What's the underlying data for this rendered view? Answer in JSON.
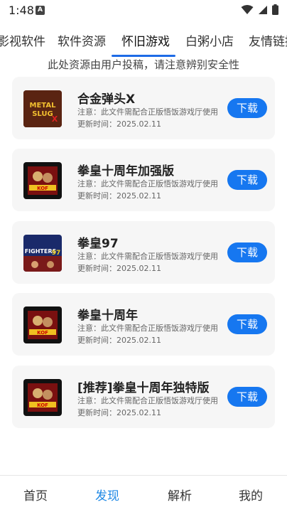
{
  "status": {
    "time": "1:48",
    "notif_letter": "A"
  },
  "tabs": [
    {
      "label": "影视软件",
      "active": false
    },
    {
      "label": "软件资源",
      "active": false
    },
    {
      "label": "怀旧游戏",
      "active": true
    },
    {
      "label": "白粥小店",
      "active": false
    },
    {
      "label": "友情链接",
      "active": false
    }
  ],
  "notice": "此处资源由用户投稿，请注意辨别安全性",
  "items": [
    {
      "title": "合金弹头X",
      "note": "注意：此文件需配合正版悟饭游戏厅使用",
      "date": "更新时间：2025.02.11",
      "button": "下载",
      "thumb_text": "METAL SLUG X"
    },
    {
      "title": "拳皇十周年加强版",
      "note": "注意：此文件需配合正版悟饭游戏厅使用",
      "date": "更新时间：2025.02.11",
      "button": "下载",
      "thumb_text": "KOF"
    },
    {
      "title": "拳皇97",
      "note": "注意：此文件需配合正版悟饭游戏厅使用",
      "date": "更新时间：2025.02.11",
      "button": "下载",
      "thumb_text": "FIGHTERS 97"
    },
    {
      "title": "拳皇十周年",
      "note": "注意：此文件需配合正版悟饭游戏厅使用",
      "date": "更新时间：2025.02.11",
      "button": "下载",
      "thumb_text": "KOF"
    },
    {
      "title": "[推荐]拳皇十周年独特版",
      "note": "注意：此文件需配合正版悟饭游戏厅使用",
      "date": "更新时间：2025.02.11",
      "button": "下载",
      "thumb_text": "KOF"
    }
  ],
  "bottom_nav": [
    {
      "label": "首页",
      "active": false
    },
    {
      "label": "发现",
      "active": true
    },
    {
      "label": "解析",
      "active": false
    },
    {
      "label": "我的",
      "active": false
    }
  ],
  "colors": {
    "accent": "#1677f0",
    "nav_active": "#1e88e5"
  }
}
